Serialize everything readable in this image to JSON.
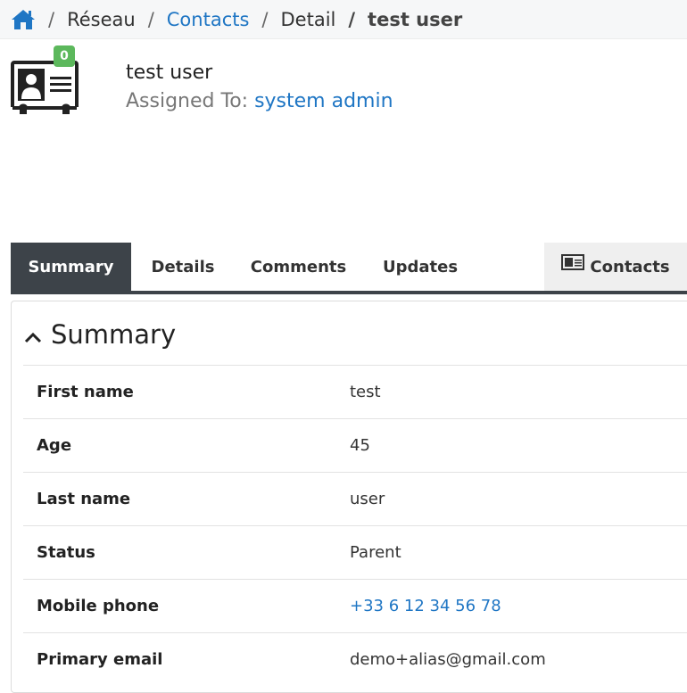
{
  "breadcrumb": {
    "items": [
      {
        "label": "Réseau"
      },
      {
        "label": "Contacts"
      },
      {
        "label": "Detail"
      },
      {
        "label": "test user"
      }
    ]
  },
  "record": {
    "badge": "0",
    "title": "test user",
    "assigned_label": "Assigned To:",
    "assigned_value": "system admin"
  },
  "tabs": [
    {
      "label": "Summary"
    },
    {
      "label": "Details"
    },
    {
      "label": "Comments"
    },
    {
      "label": "Updates"
    },
    {
      "label": "Contacts"
    }
  ],
  "summary": {
    "title": "Summary",
    "rows": [
      {
        "label": "First name",
        "value": "test"
      },
      {
        "label": "Age",
        "value": "45"
      },
      {
        "label": "Last name",
        "value": "user"
      },
      {
        "label": "Status",
        "value": "Parent"
      },
      {
        "label": "Mobile phone",
        "value": "+33 6 12 34 56 78"
      },
      {
        "label": "Primary email",
        "value": "demo+alias@gmail.com"
      }
    ]
  },
  "colors": {
    "accent_link": "#1f76c4",
    "tab_active": "#3d4349",
    "badge": "#5cb85c"
  },
  "icons": [
    "home-icon",
    "contact-card-icon",
    "chevron-up-icon"
  ]
}
